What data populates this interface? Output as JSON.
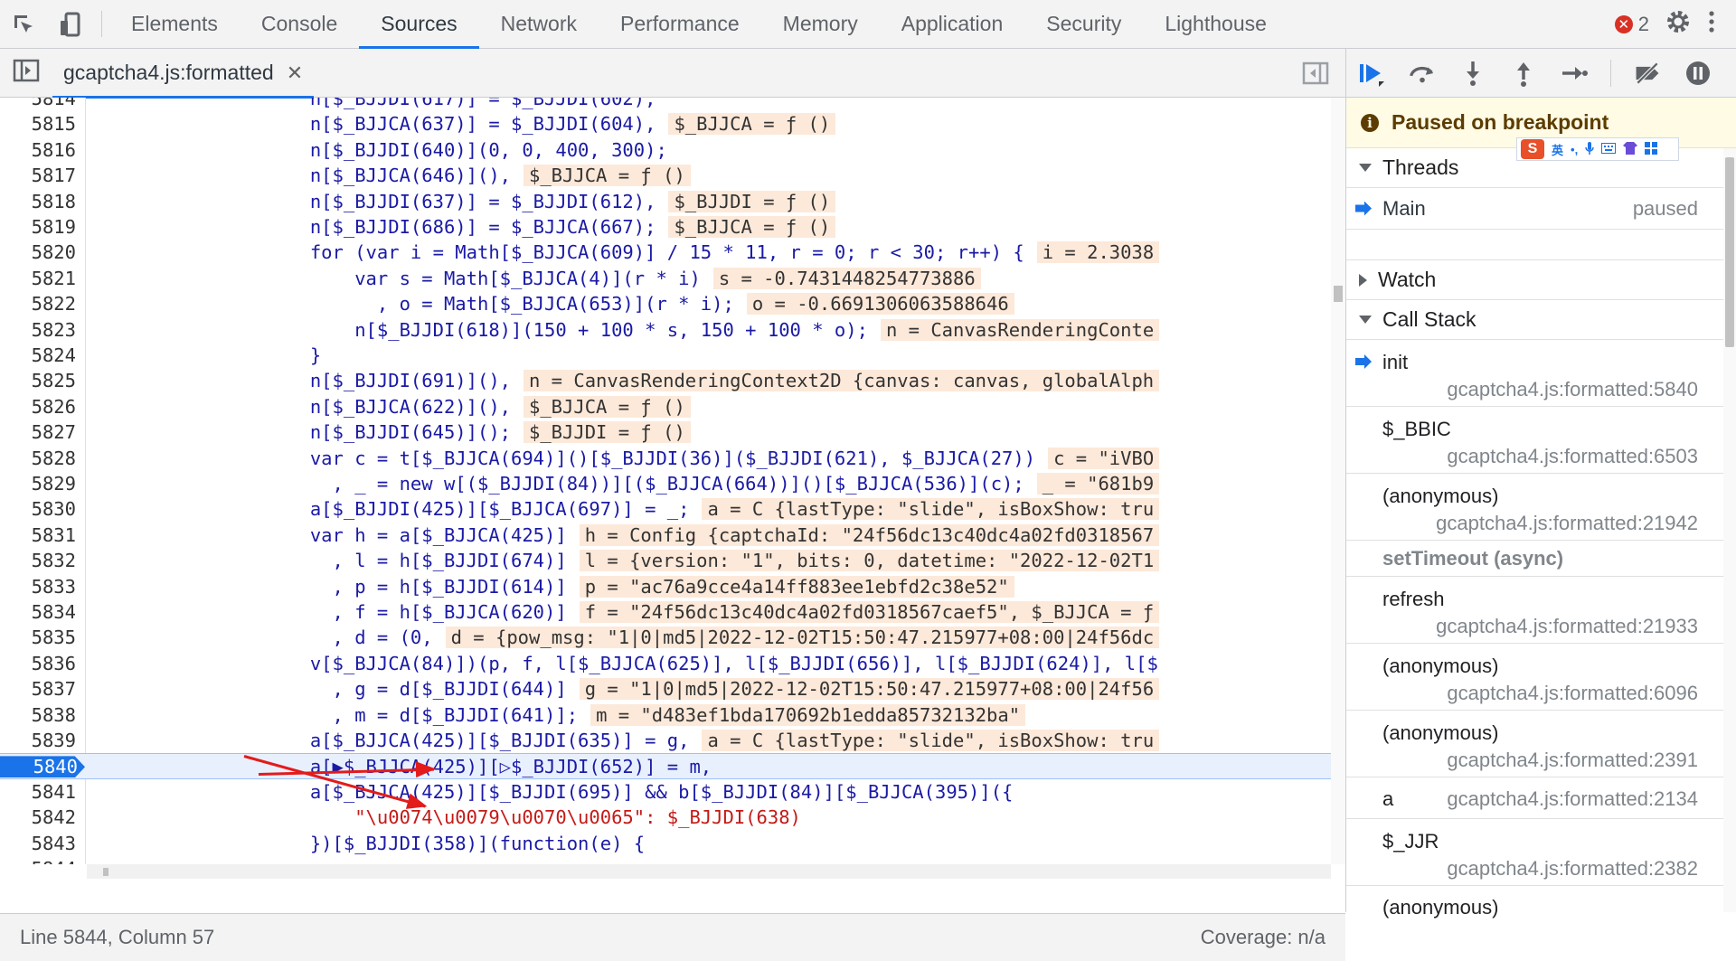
{
  "toolbar": {
    "tabs": [
      "Elements",
      "Console",
      "Sources",
      "Network",
      "Performance",
      "Memory",
      "Application",
      "Security",
      "Lighthouse"
    ],
    "active_tab": "Sources",
    "error_count": "2",
    "error_glyph": "✕"
  },
  "editor": {
    "file_tab": "gcaptcha4.js:formatted",
    "close_glyph": "✕",
    "lines": [
      {
        "n": "5814",
        "code": "                    n[$_BJJDI(617)] = $_BJJDI(602),",
        "val": ""
      },
      {
        "n": "5815",
        "code": "                    n[$_BJJCA(637)] = $_BJJDI(604),",
        "val": "$_BJJCA = ƒ ()"
      },
      {
        "n": "5816",
        "code": "                    n[$_BJJDI(640)](0, 0, 400, 300);",
        "val": ""
      },
      {
        "n": "5817",
        "code": "                    n[$_BJJCA(646)](),",
        "val": "$_BJJCA = ƒ ()"
      },
      {
        "n": "5818",
        "code": "                    n[$_BJJDI(637)] = $_BJJDI(612),",
        "val": "$_BJJDI = ƒ ()"
      },
      {
        "n": "5819",
        "code": "                    n[$_BJJDI(686)] = $_BJJCA(667);",
        "val": "$_BJJCA = ƒ ()"
      },
      {
        "n": "5820",
        "code": "                    for (var i = Math[$_BJJCA(609)] / 15 * 11, r = 0; r < 30; r++) {",
        "val": "i = 2.3038"
      },
      {
        "n": "5821",
        "code": "                        var s = Math[$_BJJCA(4)](r * i)",
        "val": "s = -0.7431448254773886"
      },
      {
        "n": "5822",
        "code": "                          , o = Math[$_BJJCA(653)](r * i);",
        "val": "o = -0.6691306063588646"
      },
      {
        "n": "5823",
        "code": "                        n[$_BJJDI(618)](150 + 100 * s, 150 + 100 * o);",
        "val": "n = CanvasRenderingConte"
      },
      {
        "n": "5824",
        "code": "                    }",
        "val": ""
      },
      {
        "n": "5825",
        "code": "                    n[$_BJJDI(691)](),",
        "val": "n = CanvasRenderingContext2D {canvas: canvas, globalAlph"
      },
      {
        "n": "5826",
        "code": "                    n[$_BJJCA(622)](),",
        "val": "$_BJJCA = ƒ ()"
      },
      {
        "n": "5827",
        "code": "                    n[$_BJJDI(645)]();",
        "val": "$_BJJDI = ƒ ()"
      },
      {
        "n": "5828",
        "code": "                    var c = t[$_BJJCA(694)]()[$_BJJDI(36)]($_BJJDI(621), $_BJJCA(27))",
        "val": "c = \"iVBO"
      },
      {
        "n": "5829",
        "code": "                      , _ = new w[($_BJJDI(84))][($_BJJCA(664))]()[$_BJJCA(536)](c);",
        "val": "_ = \"681b9"
      },
      {
        "n": "5830",
        "code": "                    a[$_BJJDI(425)][$_BJJCA(697)] = _;",
        "val": "a = C {lastType: \"slide\", isBoxShow: tru"
      },
      {
        "n": "5831",
        "code": "                    var h = a[$_BJJCA(425)]",
        "val": "h = Config {captchaId: \"24f56dc13c40dc4a02fd0318567"
      },
      {
        "n": "5832",
        "code": "                      , l = h[$_BJJDI(674)]",
        "val": "l = {version: \"1\", bits: 0, datetime: \"2022-12-02T1"
      },
      {
        "n": "5833",
        "code": "                      , p = h[$_BJJDI(614)]",
        "val": "p = \"ac76a9cce4a14ff883ee1ebfd2c38e52\""
      },
      {
        "n": "5834",
        "code": "                      , f = h[$_BJJCA(620)]",
        "val": "f = \"24f56dc13c40dc4a02fd0318567caef5\", $_BJJCA = ƒ"
      },
      {
        "n": "5835",
        "code": "                      , d = (0,",
        "val": "d = {pow_msg: \"1|0|md5|2022-12-02T15:50:47.215977+08:00|24f56dc"
      },
      {
        "n": "5836",
        "code": "                    v[$_BJJCA(84)])(p, f, l[$_BJJCA(625)], l[$_BJJDI(656)], l[$_BJJDI(624)], l[$",
        "val": ""
      },
      {
        "n": "5837",
        "code": "                      , g = d[$_BJJDI(644)]",
        "val": "g = \"1|0|md5|2022-12-02T15:50:47.215977+08:00|24f56"
      },
      {
        "n": "5838",
        "code": "                      , m = d[$_BJJDI(641)];",
        "val": "m = \"d483ef1bda170692b1edda85732132ba\""
      },
      {
        "n": "5839",
        "code": "                    a[$_BJJCA(425)][$_BJJDI(635)] = g,",
        "val": "a = C {lastType: \"slide\", isBoxShow: tru"
      },
      {
        "n": "5840",
        "code": "                    a[▶$_BJJCA(425)][▷$_BJJDI(652)] = m,",
        "val": ""
      },
      {
        "n": "5841",
        "code": "                    a[$_BJJCA(425)][$_BJJDI(695)] && b[$_BJJDI(84)][$_BJJCA(395)]({",
        "val": ""
      },
      {
        "n": "5842",
        "code": "                        \"\\u0074\\u0079\\u0070\\u0065\": $_BJJDI(638)",
        "val": ""
      },
      {
        "n": "5843",
        "code": "                    })[$_BJJDI(358)](function(e) {",
        "val": ""
      },
      {
        "n": "5844",
        "code": "",
        "val": ""
      }
    ],
    "current_line": "5840"
  },
  "status": {
    "position": "Line 5844, Column 57",
    "coverage": "Coverage: n/a"
  },
  "debugger": {
    "paused_message": "Paused on breakpoint",
    "info_glyph": "i",
    "ime_logo": "S",
    "ime_lang": "英",
    "threads_label": "Threads",
    "thread": {
      "name": "Main",
      "state": "paused"
    },
    "watch_label": "Watch",
    "callstack_label": "Call Stack",
    "frames": [
      {
        "fn": "init",
        "loc": "gcaptcha4.js:formatted:5840",
        "current": true
      },
      {
        "fn": "$_BBIC",
        "loc": "gcaptcha4.js:formatted:6503"
      },
      {
        "fn": "(anonymous)",
        "loc": "gcaptcha4.js:formatted:21942"
      }
    ],
    "async_label": "setTimeout (async)",
    "frames2": [
      {
        "fn": "refresh",
        "loc": "gcaptcha4.js:formatted:21933"
      },
      {
        "fn": "(anonymous)",
        "loc": "gcaptcha4.js:formatted:6096"
      },
      {
        "fn": "(anonymous)",
        "loc": "gcaptcha4.js:formatted:2391"
      }
    ],
    "frame_a": {
      "fn": "a",
      "loc": "gcaptcha4.js:formatted:2134"
    },
    "frame_jjr": {
      "fn": "$_JJR",
      "loc": "gcaptcha4.js:formatted:2382"
    },
    "frame_last": {
      "fn": "(anonymous)"
    }
  },
  "colors": {
    "accent": "#1a73e8",
    "paused_bg": "#fffbe5",
    "inline_value_bg": "#fde9d9",
    "arrow": "#e31b1b"
  }
}
